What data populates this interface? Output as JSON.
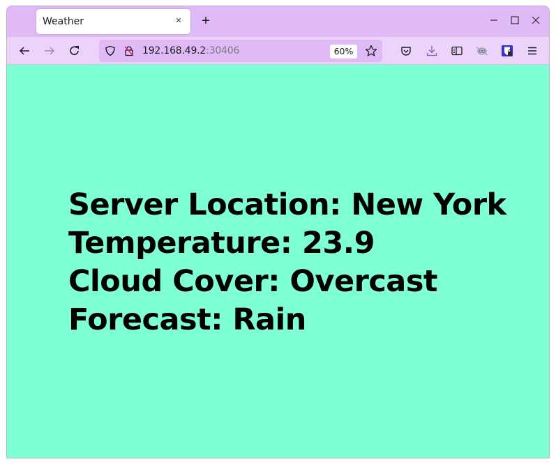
{
  "browser": {
    "tab": {
      "title": "Weather",
      "close_symbol": "×"
    },
    "new_tab_symbol": "+",
    "window_controls": {
      "minimize": "–",
      "maximize": "☐",
      "close": "✕"
    },
    "url": {
      "host": "192.168.49.2",
      "port": ":30406"
    },
    "zoom_level": "60%",
    "icons": [
      "back-icon",
      "forward-icon",
      "reload-icon",
      "shield-icon",
      "insecure-lock-icon",
      "bookmark-star-icon",
      "pocket-icon",
      "download-icon",
      "reader-view-icon",
      "extension-icon",
      "bitwarden-icon",
      "menu-icon"
    ]
  },
  "page": {
    "background_color": "#7fffd4",
    "lines": [
      "Server Location: New York",
      "Temperature: 23.9",
      "Cloud Cover: Overcast",
      "Forecast: Rain"
    ]
  }
}
